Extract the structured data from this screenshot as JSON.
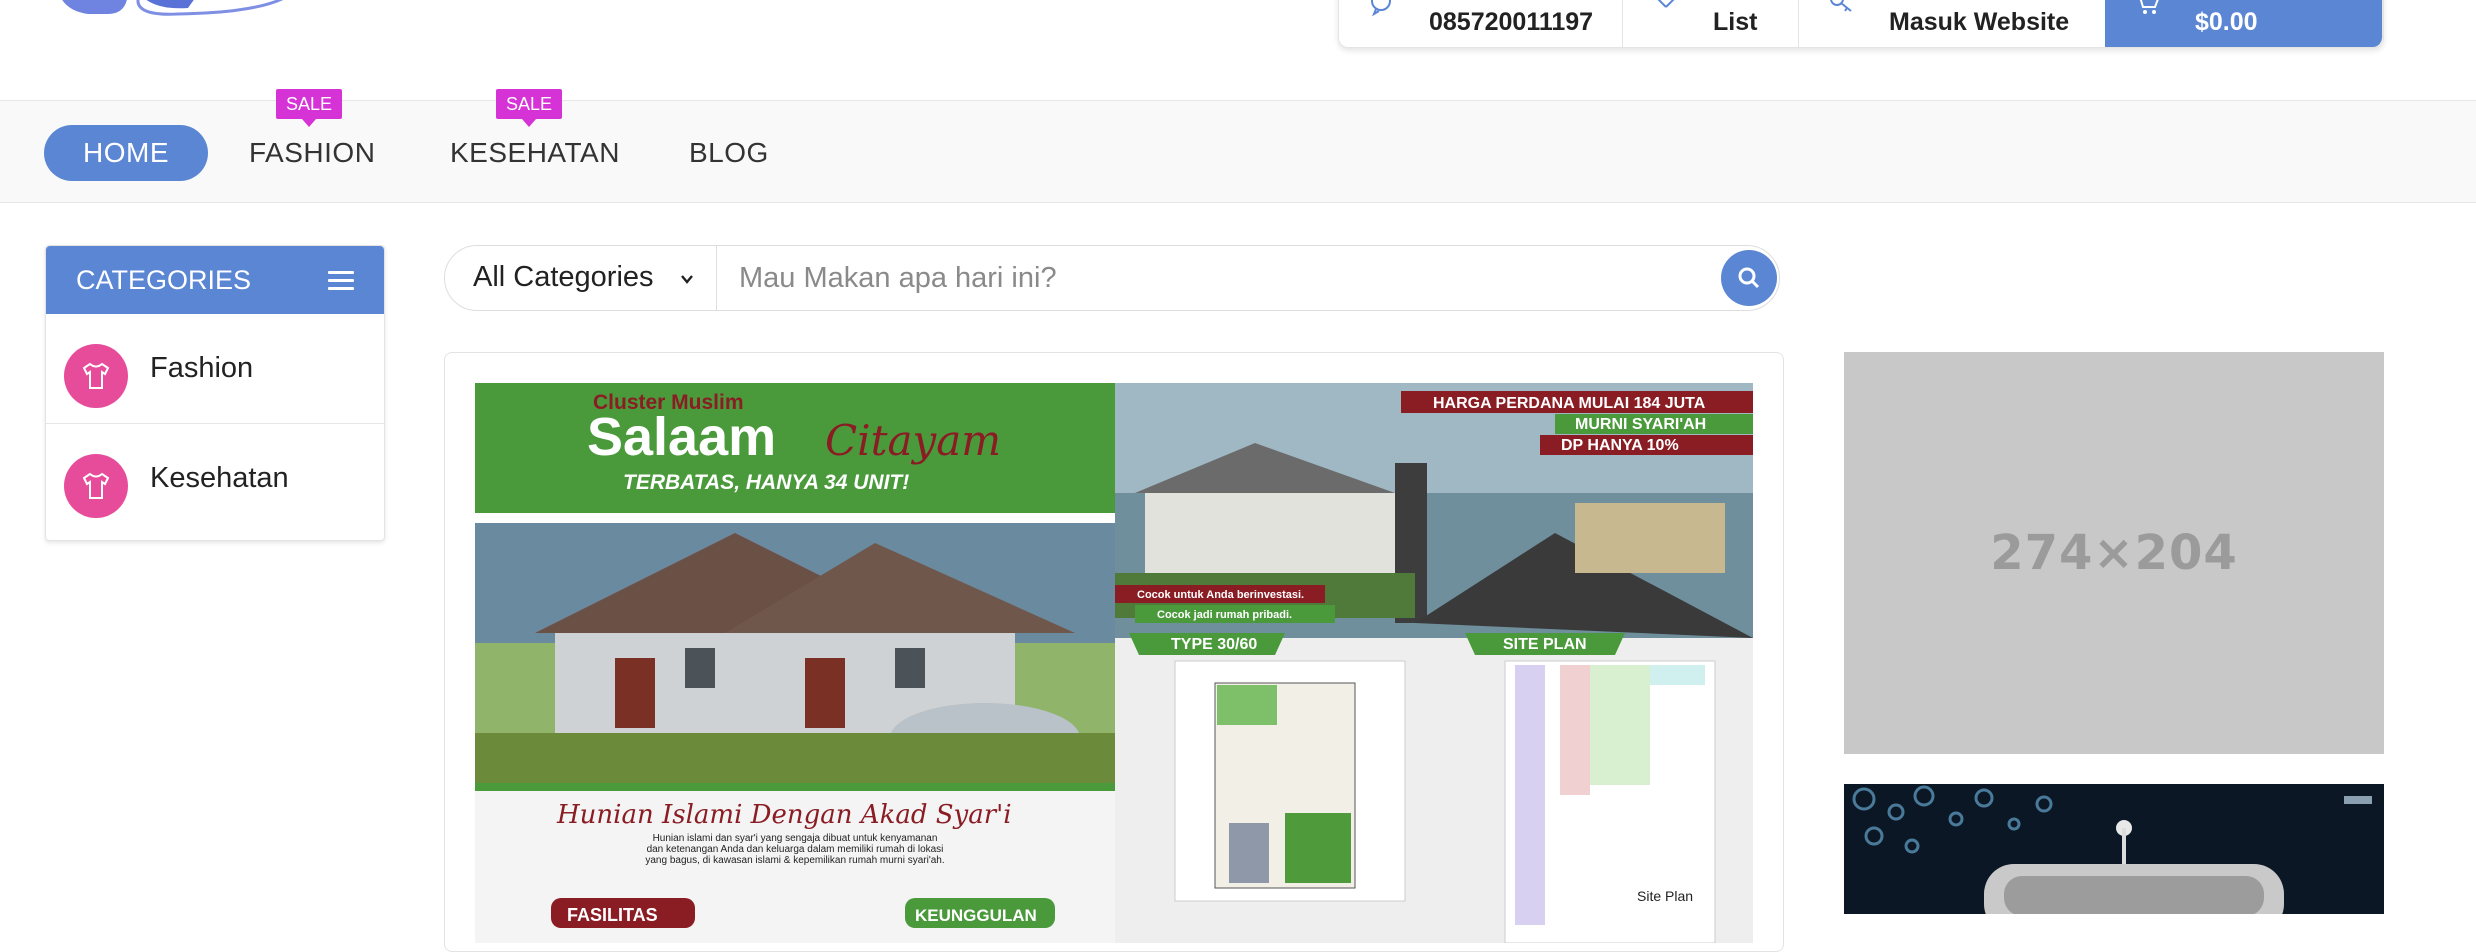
{
  "header": {
    "phone": "085720011197",
    "wishlist_label": "List",
    "login_label": "Masuk Website",
    "cart_total": "$0.00"
  },
  "nav": {
    "items": [
      {
        "label": "HOME",
        "active": true
      },
      {
        "label": "FASHION",
        "badge": "SALE"
      },
      {
        "label": "KESEHATAN",
        "badge": "SALE"
      },
      {
        "label": "BLOG"
      }
    ]
  },
  "categories": {
    "title": "CATEGORIES",
    "items": [
      {
        "label": "Fashion",
        "icon": "tshirt-icon"
      },
      {
        "label": "Kesehatan",
        "icon": "tshirt-icon"
      }
    ]
  },
  "search": {
    "category_selected": "All Categories",
    "placeholder": "Mau Makan apa hari ini?",
    "value": ""
  },
  "banner": {
    "tagline_small": "Cluster Muslim",
    "title_main": "Salaam",
    "title_script": "Citayam",
    "subtitle": "TERBATAS, HANYA 34 UNIT!",
    "features": [
      "HARGA PERDANA MULAI 184 JUTA",
      "MURNI SYARI'AH",
      "DP HANYA 10%"
    ],
    "notes": [
      "Cocok untuk Anda berinvestasi.",
      "Cocok jadi rumah pribadi."
    ],
    "type_label": "TYPE 30/60",
    "siteplan_label": "SITE PLAN",
    "headline": "Hunian Islami  Dengan Akad Syar'i",
    "body": "Hunian islami dan syar'i yang sengaja dibuat untuk kenyamanan dan ketenangan Anda dan keluarga dalam memiliki rumah di lokasi yang bagus, di kawasan islami & kepemilikan rumah murni syari'ah.",
    "fasilitas": "FASILITAS",
    "keunggulan": "KEUNGGULAN",
    "siteplan_caption": "Site Plan"
  },
  "ads": {
    "placeholder_text": "274×204"
  },
  "colors": {
    "accent": "#5b86d4",
    "sale": "#d633d6",
    "category_icon": "#e74c9a",
    "banner_green": "#4a9a3c",
    "banner_red": "#8a1c24"
  }
}
